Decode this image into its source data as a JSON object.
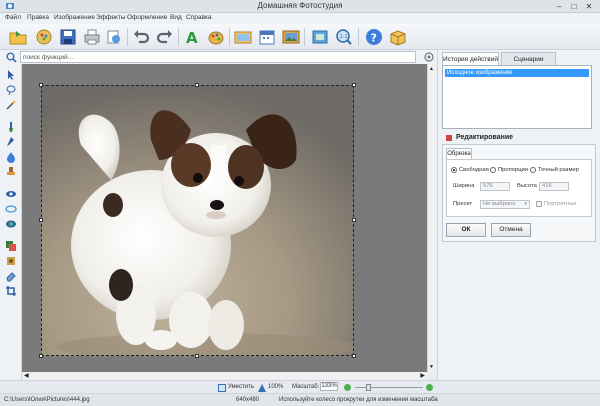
{
  "window": {
    "title": "Домашняя Фотостудия"
  },
  "menu": [
    "Файл",
    "Правка",
    "Изображение",
    "Эффекты",
    "Оформление",
    "Вид",
    "Справка"
  ],
  "search": {
    "placeholder": "поиск функций..."
  },
  "right_panel": {
    "tabs": [
      "История действий",
      "Сценарии"
    ],
    "history": [
      "Исходное изображение"
    ],
    "edit_title": "Редактирование",
    "subtab": "Обрезка",
    "crop_modes": [
      "Свободная",
      "Пропорции",
      "Точный размер"
    ],
    "width_label": "Ширина",
    "width_value": "576",
    "height_label": "Высота",
    "height_value": "416",
    "preset_label": "Пресет",
    "preset_value": "Не выбрано",
    "portrait_label": "Портретные",
    "ok_label": "ОК",
    "cancel_label": "Отмена"
  },
  "status": {
    "fit_label": "Уместить",
    "zoom_100": "100%",
    "scale_label": "Масштаб:",
    "scale_value": "133%",
    "path": "C:\\Users\\Юлия\\Pictures\\444.jpg",
    "dims": "640x480",
    "hint": "Используйте колесо прокрутки для изменения масштаба"
  },
  "colors": {
    "selection": "#3399ff",
    "accent_green": "#4caf50"
  }
}
